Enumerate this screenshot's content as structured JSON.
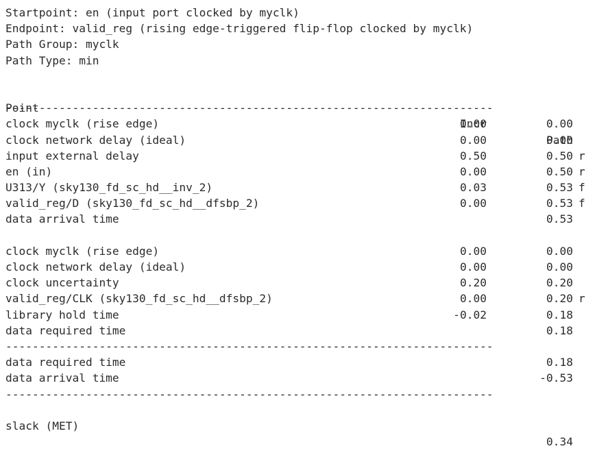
{
  "header": {
    "startpoint": "Startpoint: en (input port clocked by myclk)",
    "endpoint": "Endpoint: valid_reg (rising edge-triggered flip-flop clocked by myclk)",
    "path_group": "Path Group: myclk",
    "path_type": "Path Type: min"
  },
  "columns": {
    "point": "Point",
    "incr": "Incr",
    "path": "Path"
  },
  "separator": "-------------------------------------------------------------------------",
  "arrival_rows": [
    {
      "point": "clock myclk (rise edge)",
      "incr": "0.00",
      "path": "0.00",
      "edge": ""
    },
    {
      "point": "clock network delay (ideal)",
      "incr": "0.00",
      "path": "0.00",
      "edge": ""
    },
    {
      "point": "input external delay",
      "incr": "0.50",
      "path": "0.50",
      "edge": "r"
    },
    {
      "point": "en (in)",
      "incr": "0.00",
      "path": "0.50",
      "edge": "r"
    },
    {
      "point": "U313/Y (sky130_fd_sc_hd__inv_2)",
      "incr": "0.03",
      "path": "0.53",
      "edge": "f"
    },
    {
      "point": "valid_reg/D (sky130_fd_sc_hd__dfsbp_2)",
      "incr": "0.00",
      "path": "0.53",
      "edge": "f"
    },
    {
      "point": "data arrival time",
      "incr": "",
      "path": "0.53",
      "edge": ""
    }
  ],
  "required_rows": [
    {
      "point": "clock myclk (rise edge)",
      "incr": "0.00",
      "path": "0.00",
      "edge": ""
    },
    {
      "point": "clock network delay (ideal)",
      "incr": "0.00",
      "path": "0.00",
      "edge": ""
    },
    {
      "point": "clock uncertainty",
      "incr": "0.20",
      "path": "0.20",
      "edge": ""
    },
    {
      "point": "valid_reg/CLK (sky130_fd_sc_hd__dfsbp_2)",
      "incr": "0.00",
      "path": "0.20",
      "edge": "r"
    },
    {
      "point": "library hold time",
      "incr": "-0.02",
      "path": "0.18",
      "edge": ""
    },
    {
      "point": "data required time",
      "incr": "",
      "path": "0.18",
      "edge": ""
    }
  ],
  "summary_rows": [
    {
      "point": "data required time",
      "incr": "",
      "path": "0.18",
      "edge": ""
    },
    {
      "point": "data arrival time",
      "incr": "",
      "path": "-0.53",
      "edge": ""
    }
  ],
  "slack": {
    "point": "slack (MET)",
    "path": "0.34"
  }
}
